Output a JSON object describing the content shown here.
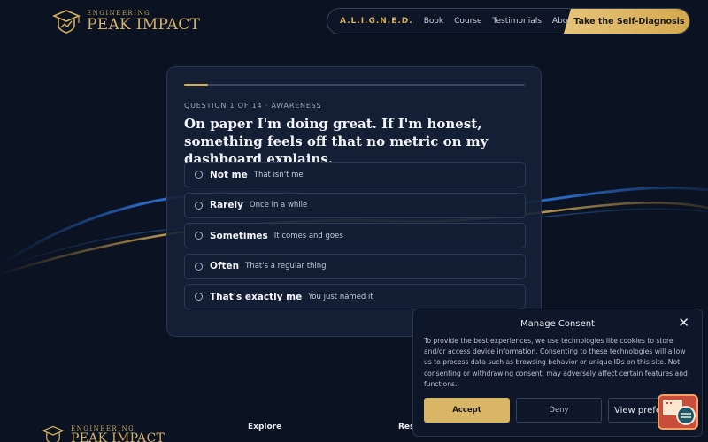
{
  "header": {
    "logo_small": "ENGINEERING",
    "logo_big": "PEAK IMPACT",
    "nav": [
      {
        "label": "A.L.I.G.N.E.D."
      },
      {
        "label": "Book"
      },
      {
        "label": "Course"
      },
      {
        "label": "Testimonials"
      },
      {
        "label": "About"
      }
    ],
    "cta": "Take the Self-Diagnosis"
  },
  "quiz": {
    "meta": "QUESTION 1 OF 14 · AWARENESS",
    "progress": 0.07,
    "question": "On paper I'm doing great. If I'm honest, something feels off that no metric on my dashboard explains.",
    "options": [
      {
        "label": "Not me",
        "desc": "That isn't me"
      },
      {
        "label": "Rarely",
        "desc": "Once in a while"
      },
      {
        "label": "Sometimes",
        "desc": "It comes and goes"
      },
      {
        "label": "Often",
        "desc": "That's a regular thing"
      },
      {
        "label": "That's exactly me",
        "desc": "You just named it"
      }
    ]
  },
  "footer": {
    "logo_small": "ENGINEERING",
    "logo_big": "PEAK IMPACT",
    "col_explore": "Explore",
    "col_res": "Res"
  },
  "consent": {
    "title": "Manage Consent",
    "close": "✕",
    "text": "To provide the best experiences, we use technologies like cookies to store and/or access device information. Consenting to these technologies will allow us to process data such as browsing behavior or unique IDs on this site. Not consenting or withdrawing consent, may adversely affect certain features and functions.",
    "accept": "Accept",
    "deny": "Deny",
    "preferences": "View preferences"
  },
  "colors": {
    "background": "#0b1322",
    "gold": "#d4ae5c",
    "card": "#162138"
  },
  "icons": {
    "logo": "mortarboard-shield-logo",
    "consent_widget": "cookie-consent-icon"
  }
}
